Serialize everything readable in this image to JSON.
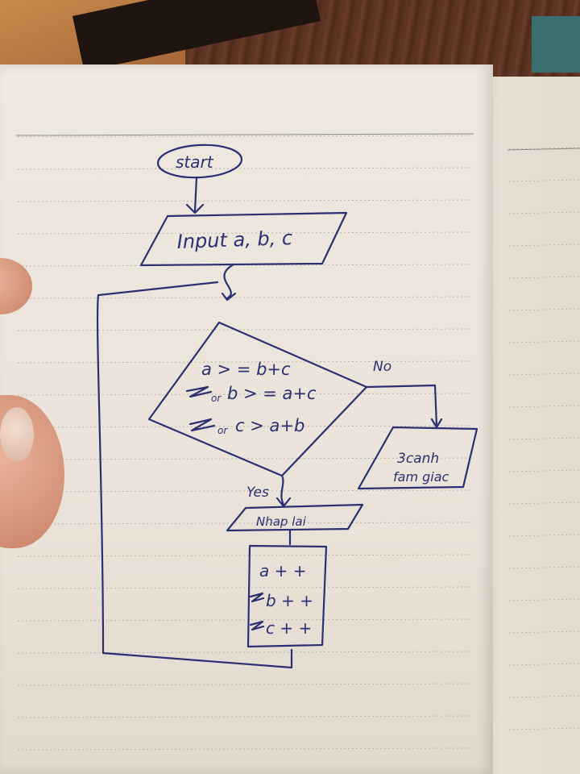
{
  "flowchart": {
    "start": "start",
    "input": "Input a, b, c",
    "condition_lines": [
      "a > = b+c",
      "b > = a+c",
      "c > a+b"
    ],
    "condition_prefixes": [
      "or",
      "or"
    ],
    "no_label": "No",
    "yes_label": "Yes",
    "no_output_lines": [
      "3canh",
      "fam giac"
    ],
    "yes_output": "Nhap lai",
    "increment_lines": [
      "a + +",
      "b + +",
      "c + +"
    ]
  },
  "colors": {
    "ink": "#2b2f73",
    "paper": "#ece5db"
  }
}
